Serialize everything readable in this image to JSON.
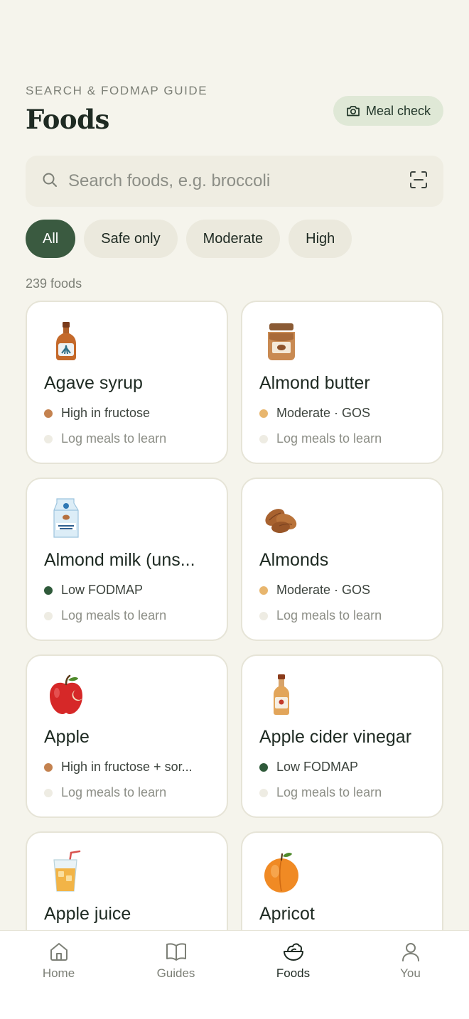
{
  "header": {
    "eyebrow": "SEARCH & FODMAP GUIDE",
    "title": "Foods",
    "meal_check_label": "Meal check"
  },
  "search": {
    "placeholder": "Search foods, e.g. broccoli",
    "value": ""
  },
  "filters": [
    {
      "label": "All",
      "active": true
    },
    {
      "label": "Safe only",
      "active": false
    },
    {
      "label": "Moderate",
      "active": false
    },
    {
      "label": "High",
      "active": false
    }
  ],
  "result_count": "239 foods",
  "colors": {
    "accent": "#3a5a40",
    "high": "#c4824f",
    "moderate": "#e8b66e",
    "low": "#2f5a3a"
  },
  "foods": [
    {
      "name": "Agave syrup",
      "icon": "agave-syrup-bottle-icon",
      "status": "high",
      "tag": "High in fructose",
      "hint": "Log meals to learn"
    },
    {
      "name": "Almond butter",
      "icon": "almond-butter-jar-icon",
      "status": "moderate",
      "tag": "Moderate · GOS",
      "hint": "Log meals to learn"
    },
    {
      "name": "Almond milk (uns...",
      "icon": "almond-milk-carton-icon",
      "status": "low",
      "tag": "Low FODMAP",
      "hint": "Log meals to learn"
    },
    {
      "name": "Almonds",
      "icon": "almonds-icon",
      "status": "moderate",
      "tag": "Moderate · GOS",
      "hint": "Log meals to learn"
    },
    {
      "name": "Apple",
      "icon": "apple-icon",
      "status": "high",
      "tag": "High in fructose + sor...",
      "hint": "Log meals to learn"
    },
    {
      "name": "Apple cider vinegar",
      "icon": "vinegar-bottle-icon",
      "status": "low",
      "tag": "Low FODMAP",
      "hint": "Log meals to learn"
    },
    {
      "name": "Apple juice",
      "icon": "juice-glass-icon",
      "status": "",
      "tag": "",
      "hint": ""
    },
    {
      "name": "Apricot",
      "icon": "apricot-icon",
      "status": "",
      "tag": "",
      "hint": ""
    }
  ],
  "nav": [
    {
      "label": "Home",
      "icon": "home-icon",
      "active": false
    },
    {
      "label": "Guides",
      "icon": "book-icon",
      "active": false
    },
    {
      "label": "Foods",
      "icon": "salad-bowl-icon",
      "active": true
    },
    {
      "label": "You",
      "icon": "person-icon",
      "active": false
    }
  ]
}
